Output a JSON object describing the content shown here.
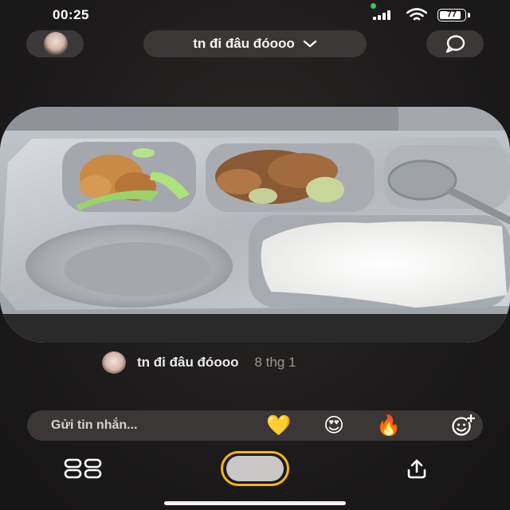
{
  "status_bar": {
    "time": "00:25",
    "battery": "77"
  },
  "header": {
    "title": "tn đi đâu đóooo",
    "avatar_icon": "profile-avatar",
    "dropdown_icon": "chevron-down-icon",
    "chat_icon": "chat-bubble-icon"
  },
  "photo": {
    "subject": "school lunch tray with chicken, stir-fried pork with squash, white rice and spoon"
  },
  "caption": {
    "name": "tn đi đâu đóooo",
    "date": "8 thg 1"
  },
  "message_bar": {
    "placeholder": "Gửi tin nhắn...",
    "reactions": [
      "💛",
      "😍",
      "🔥"
    ],
    "add_reaction_icon": "emoji-add-icon"
  },
  "bottom_bar": {
    "left_icon": "grid-icon",
    "center_icon": "shutter-button",
    "right_icon": "share-icon"
  },
  "colors": {
    "background": "#1d1b1b",
    "pill": "#3a3736",
    "shutter_ring": "#f3b51c",
    "status_dot": "#34c759"
  }
}
